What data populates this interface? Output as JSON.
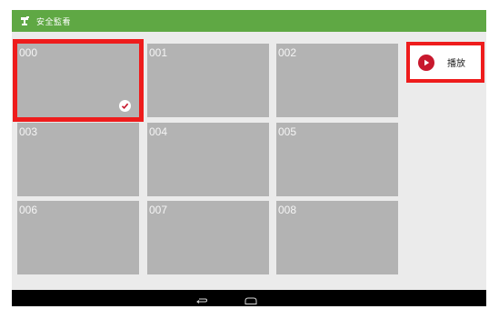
{
  "app": {
    "title": "安全監看",
    "icon": "camera-icon",
    "header_color": "#5fa844"
  },
  "grid": {
    "selected_index": 0,
    "tiles": [
      {
        "label": "000",
        "selected": true
      },
      {
        "label": "001",
        "selected": false
      },
      {
        "label": "002",
        "selected": false
      },
      {
        "label": "003",
        "selected": false
      },
      {
        "label": "004",
        "selected": false
      },
      {
        "label": "005",
        "selected": false
      },
      {
        "label": "006",
        "selected": false
      },
      {
        "label": "007",
        "selected": false
      },
      {
        "label": "008",
        "selected": false
      }
    ]
  },
  "side_panel": {
    "play_label": "播放",
    "play_icon": "play-circle-icon",
    "play_icon_color": "#c8182d"
  },
  "highlight_color": "#ee1c1c",
  "nav_bar": {
    "back_icon": "back-arrow-icon",
    "home_icon": "home-icon"
  }
}
